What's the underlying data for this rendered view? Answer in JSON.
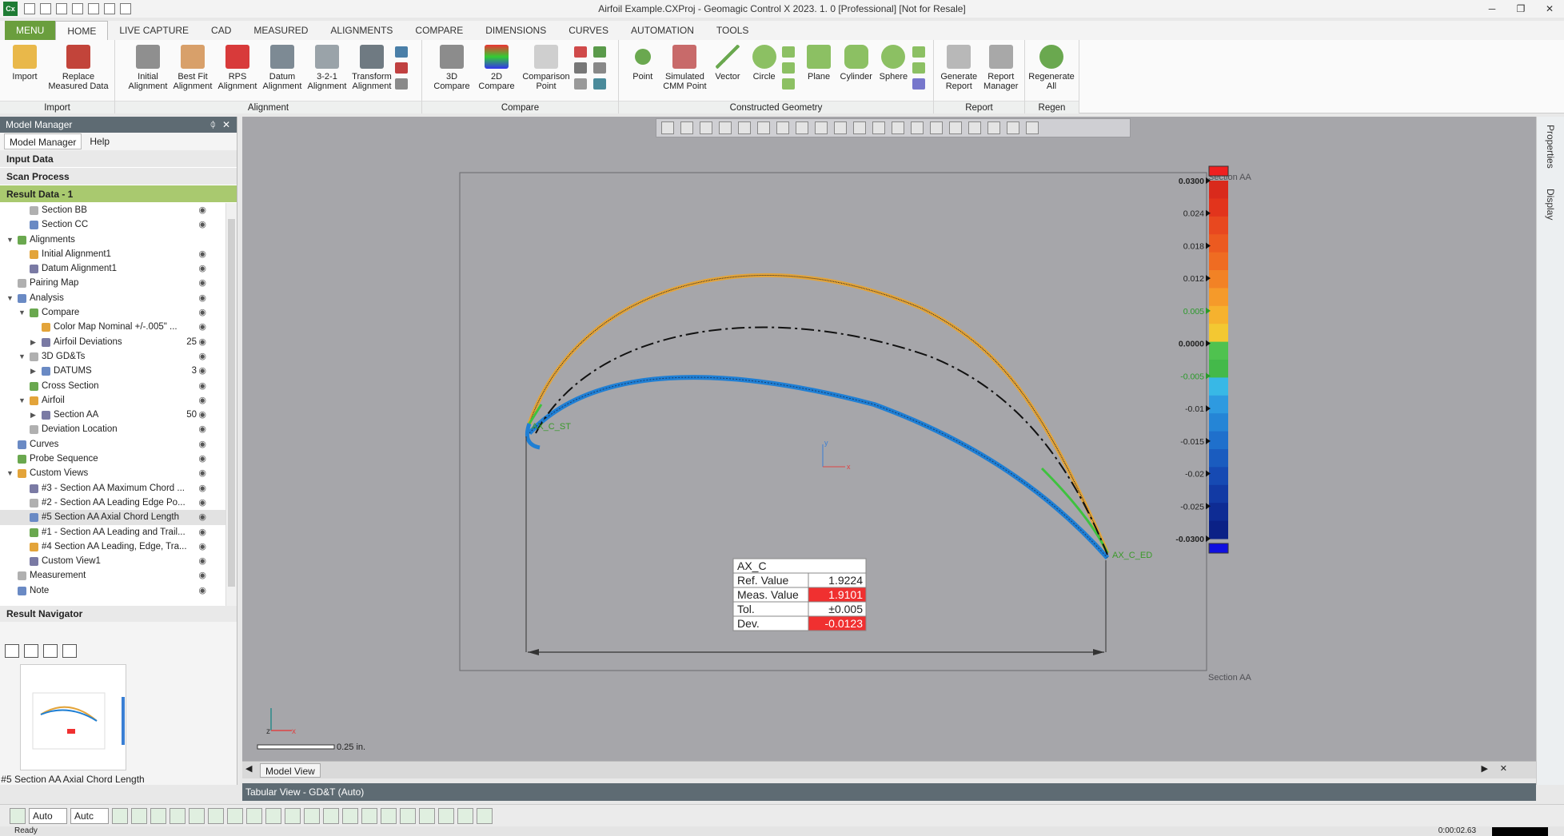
{
  "window": {
    "title": "Airfoil Example.CXProj - Geomagic Control X 2023. 1. 0 [Professional] [Not for Resale]",
    "app_icon": "Cx",
    "controls": [
      "─",
      "❐",
      "✕"
    ]
  },
  "menu_tabs": [
    "MENU",
    "HOME",
    "LIVE CAPTURE",
    "CAD",
    "MEASURED",
    "ALIGNMENTS",
    "COMPARE",
    "DIMENSIONS",
    "CURVES",
    "AUTOMATION",
    "TOOLS"
  ],
  "ribbon": {
    "import": {
      "label": "Import",
      "buttons": [
        "Import",
        "Replace Measured Data"
      ]
    },
    "alignment": {
      "label": "Alignment",
      "buttons": [
        "Initial Alignment",
        "Best Fit Alignment",
        "RPS Alignment",
        "Datum Alignment",
        "3-2-1 Alignment",
        "Transform Alignment"
      ]
    },
    "compare": {
      "label": "Compare",
      "buttons": [
        "3D Compare",
        "2D Compare",
        "Comparison Point"
      ]
    },
    "geometry": {
      "label": "Constructed Geometry",
      "buttons": [
        "Point",
        "Simulated CMM Point",
        "Vector",
        "Circle",
        "Plane",
        "Cylinder",
        "Sphere"
      ]
    },
    "report": {
      "label": "Report",
      "buttons": [
        "Generate Report",
        "Report Manager"
      ]
    },
    "regen": {
      "label": "Regen",
      "buttons": [
        "Regenerate All"
      ]
    }
  },
  "model_manager": {
    "title": "Model Manager",
    "pin": "📌",
    "close": "✕",
    "tabs": [
      "Model Manager",
      "Help"
    ],
    "sections": [
      "Input Data",
      "Scan Process",
      "Result Data - 1"
    ],
    "tree": [
      {
        "label": "Section BB",
        "indent": 2
      },
      {
        "label": "Section CC",
        "indent": 2
      },
      {
        "label": "Alignments",
        "indent": 1,
        "exp": "▼"
      },
      {
        "label": "Initial Alignment1",
        "indent": 2
      },
      {
        "label": "Datum Alignment1",
        "indent": 2
      },
      {
        "label": "Pairing Map",
        "indent": 1
      },
      {
        "label": "Analysis",
        "indent": 1,
        "exp": "▼"
      },
      {
        "label": "Compare",
        "indent": 2,
        "exp": "▼"
      },
      {
        "label": "Color Map Nominal +/-.005\" ...",
        "indent": 3
      },
      {
        "label": "Airfoil Deviations",
        "indent": 3,
        "exp": "▶",
        "count": "25"
      },
      {
        "label": "3D GD&Ts",
        "indent": 2,
        "exp": "▼"
      },
      {
        "label": "DATUMS",
        "indent": 3,
        "exp": "▶",
        "count": "3"
      },
      {
        "label": "Cross Section",
        "indent": 2
      },
      {
        "label": "Airfoil",
        "indent": 2,
        "exp": "▼"
      },
      {
        "label": "Section AA",
        "indent": 3,
        "exp": "▶",
        "count": "50"
      },
      {
        "label": "Deviation Location",
        "indent": 2
      },
      {
        "label": "Curves",
        "indent": 1
      },
      {
        "label": "Probe Sequence",
        "indent": 1
      },
      {
        "label": "Custom Views",
        "indent": 1,
        "exp": "▼"
      },
      {
        "label": "#3 - Section AA Maximum Chord ...",
        "indent": 2
      },
      {
        "label": "#2 - Section AA Leading Edge Po...",
        "indent": 2
      },
      {
        "label": "#5 Section AA Axial Chord Length",
        "indent": 2,
        "sel": true
      },
      {
        "label": "#1 - Section AA Leading and Trail...",
        "indent": 2
      },
      {
        "label": "#4 Section AA Leading, Edge, Tra...",
        "indent": 2
      },
      {
        "label": "Custom View1",
        "indent": 2
      },
      {
        "label": "Measurement",
        "indent": 1
      },
      {
        "label": "Note",
        "indent": 1
      }
    ],
    "result_navigator": "Result Navigator",
    "thumb_caption": "#5 Section AA Axial Chord Length"
  },
  "viewport": {
    "section_label_top": "Section AA",
    "section_label_bottom": "Section AA",
    "label_le": "AX_C_ST",
    "label_te": "AX_C_ED",
    "scale": "0.25 in.",
    "axis_y": "y",
    "axis_x": "x",
    "axis_z": "z",
    "colors": {
      "pressure": "#1f7fd4",
      "suction": "#e3a43a",
      "green": "#3ec23e",
      "bg": "#a6a6aa",
      "fail": "#f03030"
    }
  },
  "dim_table": {
    "name": "AX_C",
    "rows": [
      {
        "label": "Ref. Value",
        "value": "1.9224",
        "fail": false
      },
      {
        "label": "Meas. Value",
        "value": "1.9101",
        "fail": true
      },
      {
        "label": "Tol.",
        "value": "±0.005",
        "fail": false
      },
      {
        "label": "Dev.",
        "value": "-0.0123",
        "fail": true
      }
    ]
  },
  "color_bar": {
    "labels": [
      "0.0300",
      "0.024",
      "0.018",
      "0.012",
      "0.005",
      "0.0000",
      "-0.005",
      "-0.01",
      "-0.015",
      "-0.02",
      "-0.025",
      "-0.0300"
    ],
    "colors": [
      "#d92a1c",
      "#e2341c",
      "#e8481f",
      "#ec5a20",
      "#ef6c22",
      "#f28225",
      "#f59a2a",
      "#f6b22e",
      "#f3c832",
      "#4fc24f",
      "#44b94a",
      "#38b8e6",
      "#2e9ae0",
      "#2585d6",
      "#1f70cc",
      "#1a5cbf",
      "#164ab3",
      "#123aa4",
      "#0e2c94",
      "#0b2186"
    ]
  },
  "side_tabs": [
    "Properties",
    "Display"
  ],
  "bottom": {
    "model_view": "Model View",
    "tabular": "Tabular View - GD&T (Auto)",
    "auto1": "Auto",
    "auto2": "Autc",
    "status": "Ready",
    "time": "0:00:02.63"
  }
}
